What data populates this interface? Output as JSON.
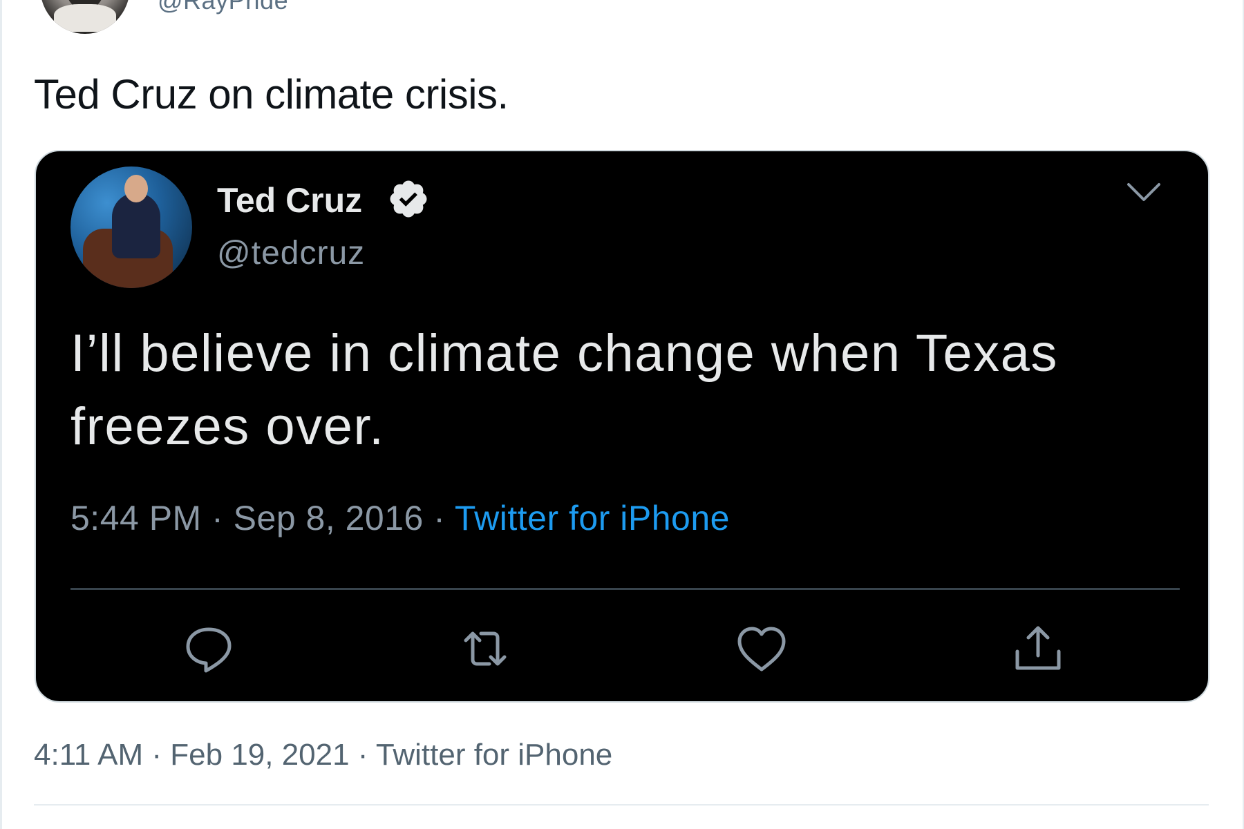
{
  "author": {
    "handle": "@RayPride"
  },
  "tweet": {
    "text": "Ted Cruz on climate crisis."
  },
  "quoted": {
    "name": "Ted Cruz",
    "handle": "@tedcruz",
    "body": "I’ll believe in climate change when Texas freezes over.",
    "time": "5:44 PM",
    "sep1": " · ",
    "date": "Sep 8, 2016",
    "sep2": " · ",
    "source": "Twitter for iPhone",
    "icons": [
      "verified-icon",
      "chevron-down-icon",
      "reply-icon",
      "retweet-icon",
      "like-icon",
      "share-icon"
    ]
  },
  "footer": {
    "meta": "4:11 AM · Feb 19, 2021 · Twitter for iPhone"
  },
  "colors": {
    "card_bg": "#000000",
    "link": "#1d9bf0",
    "muted": "#8b98a5"
  }
}
